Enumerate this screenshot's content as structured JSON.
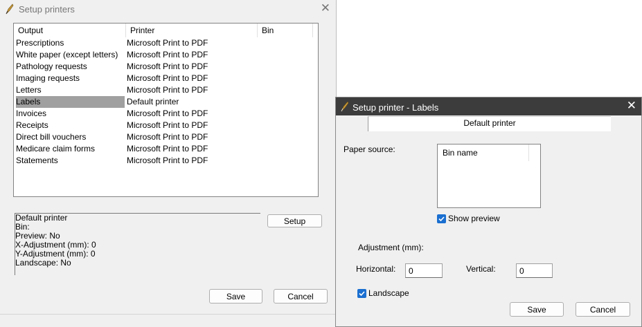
{
  "main_window": {
    "title": "Setup printers",
    "columns": [
      "Output",
      "Printer",
      "Bin"
    ],
    "rows": [
      {
        "output": "Prescriptions",
        "printer": "Microsoft Print to PDF",
        "bin": ""
      },
      {
        "output": "White paper (except letters)",
        "printer": "Microsoft Print to PDF",
        "bin": ""
      },
      {
        "output": "Pathology requests",
        "printer": "Microsoft Print to PDF",
        "bin": ""
      },
      {
        "output": "Imaging requests",
        "printer": "Microsoft Print to PDF",
        "bin": ""
      },
      {
        "output": "Letters",
        "printer": "Microsoft Print to PDF",
        "bin": ""
      },
      {
        "output": "Labels",
        "printer": "Default printer",
        "bin": "",
        "selected": true
      },
      {
        "output": "Invoices",
        "printer": "Microsoft Print to PDF",
        "bin": ""
      },
      {
        "output": "Receipts",
        "printer": "Microsoft Print to PDF",
        "bin": ""
      },
      {
        "output": "Direct bill vouchers",
        "printer": "Microsoft Print to PDF",
        "bin": ""
      },
      {
        "output": "Medicare claim forms",
        "printer": "Microsoft Print to PDF",
        "bin": ""
      },
      {
        "output": "Statements",
        "printer": "Microsoft Print to PDF",
        "bin": ""
      }
    ],
    "info": {
      "printer": "Default printer",
      "bin": "Bin:",
      "preview": "Preview: No",
      "x_adjust": "X-Adjustment (mm): 0",
      "y_adjust": "Y-Adjustment (mm): 0",
      "landscape": "Landscape: No"
    },
    "setup_label": "Setup",
    "save_label": "Save",
    "cancel_label": "Cancel"
  },
  "dialog": {
    "title": "Setup printer - Labels",
    "printer_tab": "Default printer",
    "paper_source_label": "Paper source:",
    "bin_column": "Bin name",
    "show_preview_label": "Show preview",
    "show_preview_checked": true,
    "adjustment_label": "Adjustment (mm):",
    "horizontal_label": "Horizontal:",
    "horizontal_value": "0",
    "vertical_label": "Vertical:",
    "vertical_value": "0",
    "landscape_label": "Landscape",
    "landscape_checked": true,
    "save_label": "Save",
    "cancel_label": "Cancel"
  },
  "colors": {
    "dialog_titlebar": "#3c3c3c",
    "window_bg": "#f0f0f0",
    "selection": "#a0a0a0",
    "checkbox_accent": "#1a6fd0"
  }
}
